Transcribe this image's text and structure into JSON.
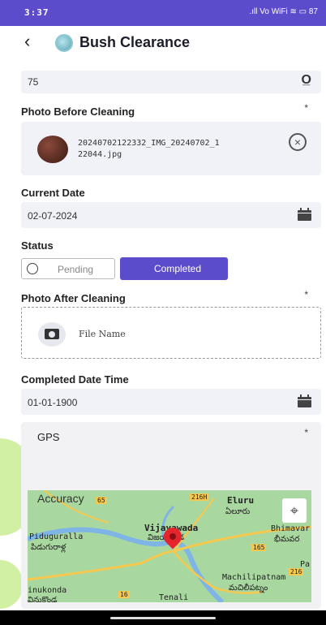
{
  "status_bar": {
    "time": "3:37",
    "icons": ".ıll Vo WiFi ≋ ▭ 87"
  },
  "header": {
    "title": "Bush Clearance"
  },
  "id_field": {
    "value": "75"
  },
  "photo_before": {
    "label": "Photo Before Cleaning",
    "required": "*",
    "filename_line1": "20240702122332_IMG_20240702_1",
    "filename_line2": "22044.jpg"
  },
  "current_date": {
    "label": "Current Date",
    "value": "02-07-2024"
  },
  "status": {
    "label": "Status",
    "options": [
      "Pending",
      "Completed"
    ],
    "selected": "Completed"
  },
  "photo_after": {
    "label": "Photo After Cleaning",
    "required": "*",
    "placeholder": "File Name"
  },
  "completed_date": {
    "label": "Completed Date Time",
    "value": "01-01-1900"
  },
  "gps": {
    "label": "GPS",
    "required": "*",
    "accuracy_label": "Accuracy"
  },
  "map": {
    "places": [
      "Eluru",
      "ఏలూరు",
      "Vijayawada",
      "విజయవాడ",
      "Piduguralla",
      "పిడుగురాళ్ల",
      "Bhimavar",
      "భీమవర",
      "Machilipatnam",
      "మచిలీపట్నం",
      "Tenali",
      "inukonda",
      "వినుకొండ",
      "Pa"
    ],
    "road_markers": [
      "65",
      "216H",
      "165",
      "216",
      "16"
    ],
    "colors": {
      "land": "#a9d7a0",
      "water": "#7fb5e6",
      "road": "#f7c84e",
      "pin": "#e5242b"
    }
  },
  "colors": {
    "accent": "#5b4ccc",
    "field_bg": "#f0f2f8"
  }
}
